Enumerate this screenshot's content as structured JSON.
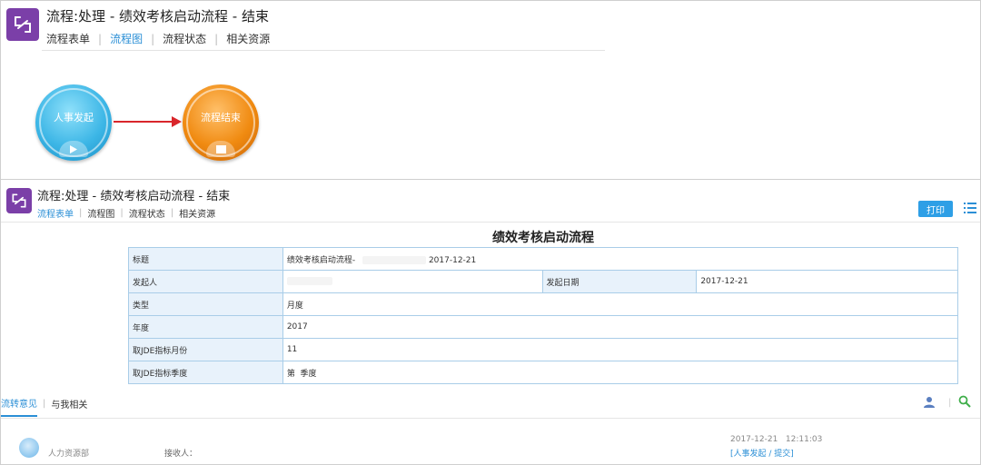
{
  "top": {
    "title": "流程:处理 - 绩效考核启动流程 - 结束",
    "tabs": [
      "流程表单",
      "流程图",
      "流程状态",
      "相关资源"
    ],
    "active_tab": "流程图",
    "nodes": {
      "start": "人事发起",
      "end": "流程结束"
    }
  },
  "bottom": {
    "title": "流程:处理 - 绩效考核启动流程 - 结束",
    "tabs": [
      "流程表单",
      "流程图",
      "流程状态",
      "相关资源"
    ],
    "active_tab": "流程表单",
    "print_label": "打印",
    "form": {
      "heading": "绩效考核启动流程",
      "rows": {
        "title_label": "标题",
        "title_value": "绩效考核启动流程-",
        "title_date": "2017-12-21",
        "initiator_label": "发起人",
        "date_label": "发起日期",
        "date_value": "2017-12-21",
        "type_label": "类型",
        "type_value": "月度",
        "year_label": "年度",
        "year_value": "2017",
        "month_label": "取JDE指标月份",
        "month_value": "11",
        "quarter_label": "取JDE指标季度",
        "quarter_value": "第  季度"
      }
    },
    "opinions": {
      "tabs": [
        "流转意见",
        "与我相关"
      ],
      "entry": {
        "dept": "人力资源部",
        "receiver_label": "接收人：",
        "time": "2017-12-21   12:11:03",
        "action": "[人事发起 / 提交]"
      }
    }
  },
  "colors": {
    "accent": "#2b8fd6",
    "app_icon": "#7b3fa8",
    "start_node": "#3cb6e6",
    "end_node": "#f08a10",
    "arrow": "#d9262b",
    "print_button": "#2e9fe6"
  }
}
